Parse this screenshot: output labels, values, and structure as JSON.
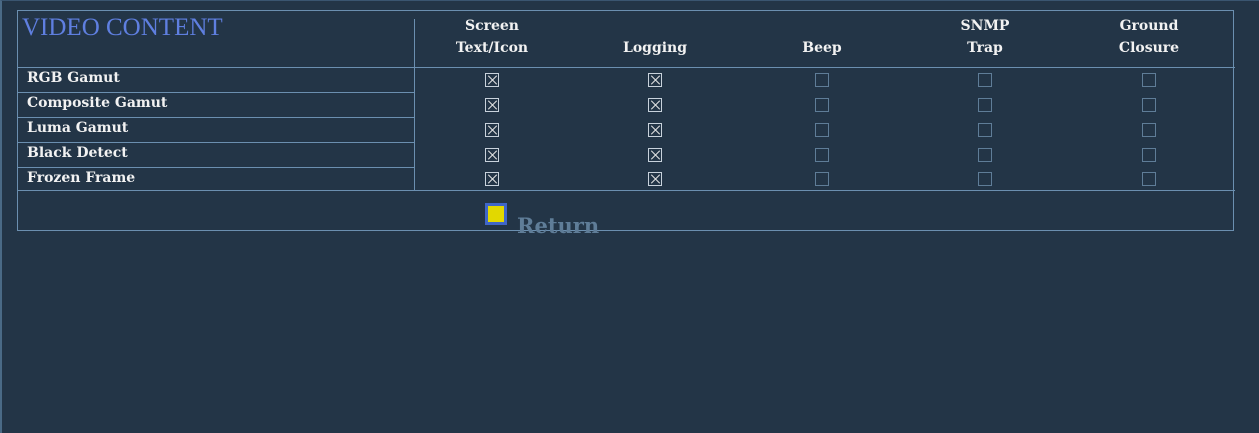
{
  "title": "VIDEO CONTENT",
  "columns": [
    {
      "line1": "Screen",
      "line2": "Text/Icon"
    },
    {
      "line1": "",
      "line2": "Logging"
    },
    {
      "line1": "",
      "line2": "Beep"
    },
    {
      "line1": "SNMP",
      "line2": "Trap"
    },
    {
      "line1": "Ground",
      "line2": "Closure"
    }
  ],
  "rows": [
    {
      "label": "RGB Gamut",
      "checks": [
        true,
        true,
        false,
        false,
        false
      ]
    },
    {
      "label": "Composite Gamut",
      "checks": [
        true,
        true,
        false,
        false,
        false
      ]
    },
    {
      "label": "Luma Gamut",
      "checks": [
        true,
        true,
        false,
        false,
        false
      ]
    },
    {
      "label": "Black Detect",
      "checks": [
        true,
        true,
        false,
        false,
        false
      ]
    },
    {
      "label": "Frozen Frame",
      "checks": [
        true,
        true,
        false,
        false,
        false
      ]
    }
  ],
  "return_label": "Return",
  "colors": {
    "background": "#233547",
    "title": "#5f7fe0",
    "grid_line": "#6b8fb0",
    "return_button": "#e2d800"
  }
}
